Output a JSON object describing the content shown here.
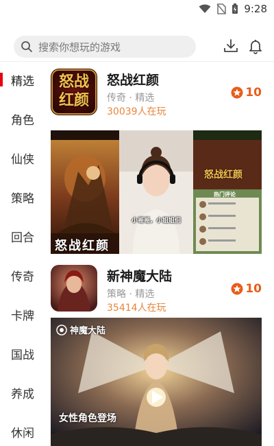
{
  "status": {
    "time": "9:28"
  },
  "search": {
    "placeholder": "搜索你想玩的游戏"
  },
  "sidebar": {
    "items": [
      {
        "label": "精选"
      },
      {
        "label": "角色"
      },
      {
        "label": "仙侠"
      },
      {
        "label": "策略"
      },
      {
        "label": "回合"
      },
      {
        "label": "传奇"
      },
      {
        "label": "卡牌"
      },
      {
        "label": "国战"
      },
      {
        "label": "养成"
      },
      {
        "label": "休闲"
      }
    ]
  },
  "games": [
    {
      "name": "怒战红颜",
      "tags": "传奇 · 精选",
      "players": "30039人在玩",
      "score": "10",
      "icon_text": "怒战红颜",
      "banner_title": "怒战红颜",
      "overlay_caption": "小哥哥，小姐姐们",
      "side_title": "怒战红颜",
      "side_section": "热门评论"
    },
    {
      "name": "新神魔大陆",
      "tags": "策略 · 精选",
      "players": "35414人在玩",
      "score": "10",
      "logo_text": "神魔大陆",
      "banner_caption": "女性角色登场"
    }
  ],
  "colors": {
    "accent": "#e60012",
    "score": "#e85d1a",
    "players": "#e8853a"
  }
}
